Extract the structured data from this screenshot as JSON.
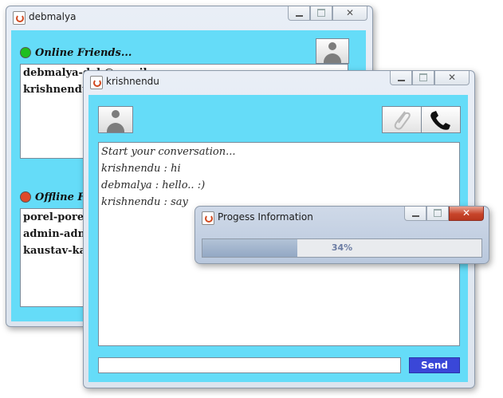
{
  "window_debmalya": {
    "title": "debmalya",
    "online_label": "Online Friends...",
    "online_friends": [
      "debmalya-deb@gmail",
      "krishnendu"
    ],
    "offline_label": "Offline Friends",
    "offline_friends": [
      "porel-porel",
      "admin-admin",
      "kaustav-ka"
    ]
  },
  "window_chat": {
    "title": "krishnendu",
    "status": "online",
    "messages": [
      "Start your conversation...",
      "krishnendu : hi",
      "debmalya : hello.. :)",
      "krishnendu : say"
    ],
    "input_value": "",
    "send_label": "Send"
  },
  "progress_dialog": {
    "title": "Progess Information",
    "percent_text": "34%",
    "value": 34
  },
  "colors": {
    "panel_bg": "#65dcf8",
    "send_button": "#3a47d8",
    "online_dot": "#1fbf1f",
    "offline_dot": "#e04a2a"
  },
  "icons": [
    "java-icon",
    "avatar-icon",
    "paperclip-icon",
    "phone-icon"
  ]
}
